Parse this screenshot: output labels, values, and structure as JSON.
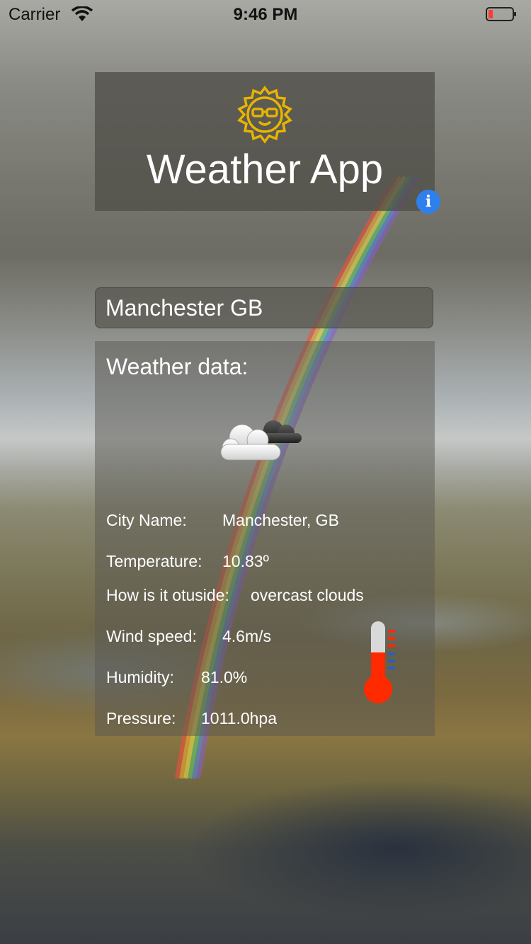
{
  "status_bar": {
    "carrier": "Carrier",
    "time": "9:46 PM",
    "wifi_icon": "wifi-icon",
    "battery_icon": "battery-low-icon"
  },
  "header": {
    "icon": "sun-with-sunglasses-icon",
    "title": "Weather App",
    "info_icon": "info-icon",
    "info_label": "i"
  },
  "search": {
    "value": "Manchester GB"
  },
  "weather": {
    "section_title": "Weather data:",
    "condition_icon": "cloudy-icon",
    "thermometer_icon": "thermometer-icon",
    "rows": [
      {
        "label": "City Name:",
        "value": "Manchester, GB"
      },
      {
        "label": "Temperature:",
        "value": "10.83º"
      },
      {
        "label": "How is it otuside:",
        "value": "overcast clouds"
      },
      {
        "label": "Wind speed:",
        "value": "4.6m/s"
      },
      {
        "label": "Humidity:",
        "value": "81.0%"
      },
      {
        "label": "Pressure:",
        "value": "1011.0hpa"
      }
    ]
  },
  "colors": {
    "accent_info": "#2f80ed",
    "sun_icon": "#e8b400",
    "thermometer_red": "#ff2a00",
    "battery_low": "#ff3b30"
  }
}
